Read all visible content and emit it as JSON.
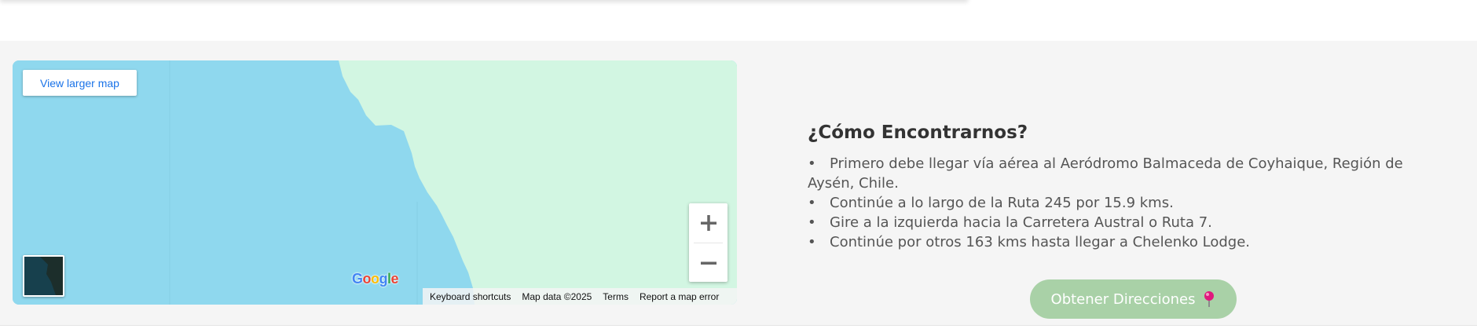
{
  "map": {
    "view_larger_label": "View larger map",
    "zoom_in_label": "+",
    "zoom_out_label": "−",
    "google_logo_text": [
      "G",
      "o",
      "o",
      "g",
      "l",
      "e"
    ],
    "attribution": {
      "keyboard": "Keyboard shortcuts",
      "data": "Map data ©2025",
      "terms": "Terms",
      "report": "Report a map error"
    },
    "colors": {
      "water": "#8fd8ee",
      "land": "#d2f6e2"
    }
  },
  "directions": {
    "title": "¿Cómo Encontrarnos?",
    "steps": [
      "Primero debe llegar vía aérea al Aeródromo Balmaceda de Coyhaique, Región de Aysén, Chile.",
      "Continúe a lo largo de la Ruta 245 por 15.9 kms.",
      "Gire a la izquierda hacia la Carretera Austral o Ruta 7.",
      "Continúe por otros 163 kms hasta llegar a Chelenko Lodge."
    ],
    "button_label": "Obtener Direcciones",
    "button_icon": "map-pin-icon",
    "button_color": "#a9d1a7"
  }
}
